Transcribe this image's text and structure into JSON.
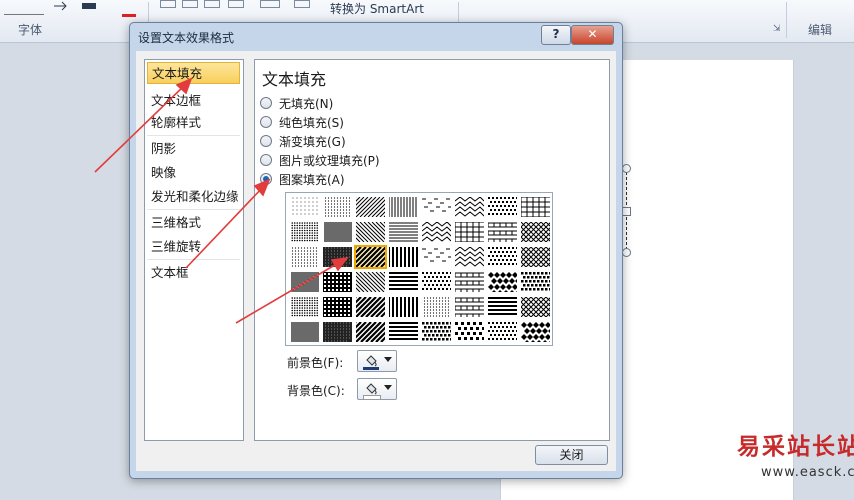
{
  "ribbon": {
    "font_group": "字体",
    "edit_group": "编辑",
    "smartart": "转换为 SmartArt",
    "launcher": "⇲"
  },
  "dialog": {
    "title": "设置文本效果格式",
    "help": "?",
    "close_x": "✕",
    "categories": [
      "文本填充",
      "文本边框",
      "轮廓样式",
      "阴影",
      "映像",
      "发光和柔化边缘",
      "三维格式",
      "三维旋转",
      "文本框"
    ],
    "selected_category": "文本填充",
    "panel_title": "文本填充",
    "fill_options": [
      "无填充(N)",
      "纯色填充(S)",
      "渐变填充(G)",
      "图片或纹理填充(P)",
      "图案填充(A)"
    ],
    "selected_fill": "图案填充(A)",
    "pattern_selected": "row 3, column 3",
    "foreground_label": "前景色(F):",
    "background_label": "背景色(C):",
    "foreground_color": "#1f3a78",
    "background_color": "#ffffff",
    "close_button": "关闭"
  },
  "watermark": {
    "cn": "易采站长站",
    "url": "www.easck.com"
  },
  "colors": {
    "accent": "#f8cf5c",
    "arrow": "#e23c3c"
  }
}
